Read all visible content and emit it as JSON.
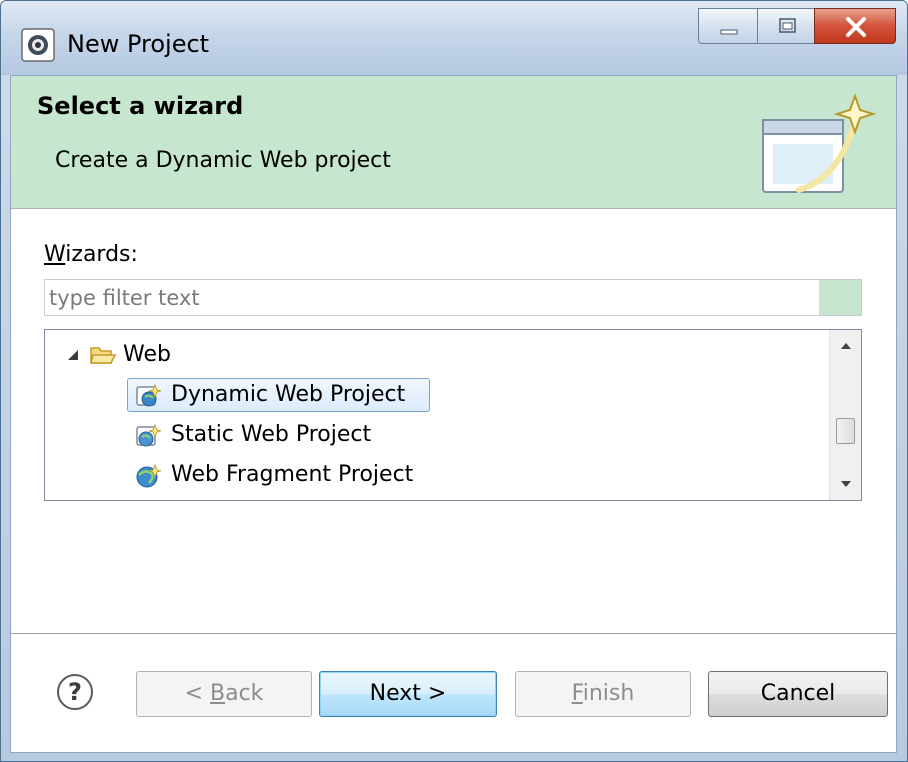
{
  "window": {
    "title": "New Project",
    "title_icon": "eclipse-icon",
    "controls": [
      "minimize-icon",
      "maximize-icon",
      "close-icon"
    ]
  },
  "banner": {
    "title": "Select a wizard",
    "description": "Create a Dynamic Web project",
    "image_icon": "wizard-banner-icon"
  },
  "wizards": {
    "label_mnemonic": "W",
    "label_rest": "izards:",
    "filter_placeholder": "type filter text",
    "filter_value": ""
  },
  "tree": {
    "category": {
      "label": "Web",
      "expanded": true,
      "icon": "open-folder-icon"
    },
    "items": [
      {
        "label": "Dynamic Web Project",
        "icon": "dynamic-web-project-icon",
        "selected": true
      },
      {
        "label": "Static Web Project",
        "icon": "static-web-project-icon",
        "selected": false
      },
      {
        "label": "Web Fragment Project",
        "icon": "web-fragment-project-icon",
        "selected": false
      }
    ]
  },
  "buttons": {
    "help_icon": "help-icon",
    "back_prefix": "< ",
    "back_mnemonic": "B",
    "back_rest": "ack",
    "next": "Next >",
    "finish_mnemonic": "F",
    "finish_rest": "inish",
    "cancel": "Cancel"
  },
  "colors": {
    "banner_background": "#c7e6cf",
    "selection_border": "#7da2ce",
    "default_button": "#bee6fd",
    "disabled_text": "#8d8d8d"
  }
}
